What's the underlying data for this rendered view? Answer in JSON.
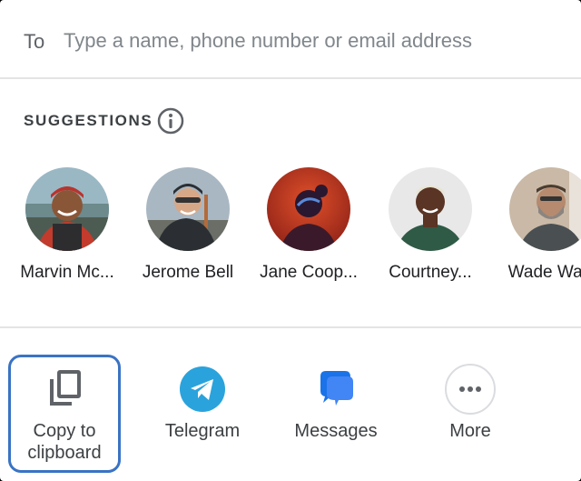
{
  "to_field": {
    "label": "To",
    "placeholder": "Type a name, phone number or email address",
    "value": ""
  },
  "suggestions": {
    "title": "SUGGESTIONS",
    "contacts": [
      {
        "name": "Marvin Mc...",
        "icon": "avatar-photo"
      },
      {
        "name": "Jerome Bell",
        "icon": "avatar-photo"
      },
      {
        "name": "Jane Coop...",
        "icon": "avatar-photo"
      },
      {
        "name": "Courtney...",
        "icon": "avatar-photo"
      },
      {
        "name": "Wade Warr",
        "icon": "avatar-photo"
      }
    ]
  },
  "share_targets": [
    {
      "label_line1": "Copy to",
      "label_line2": "clipboard",
      "icon": "copy-icon",
      "selected": true
    },
    {
      "label_line1": "Telegram",
      "icon": "telegram-icon"
    },
    {
      "label_line1": "Messages",
      "icon": "messages-icon"
    },
    {
      "label_line1": "More",
      "icon": "more-icon"
    }
  ],
  "colors": {
    "selection_outline": "#3a73c4",
    "telegram": "#2aa3dc",
    "messages": "#1a73e8"
  }
}
